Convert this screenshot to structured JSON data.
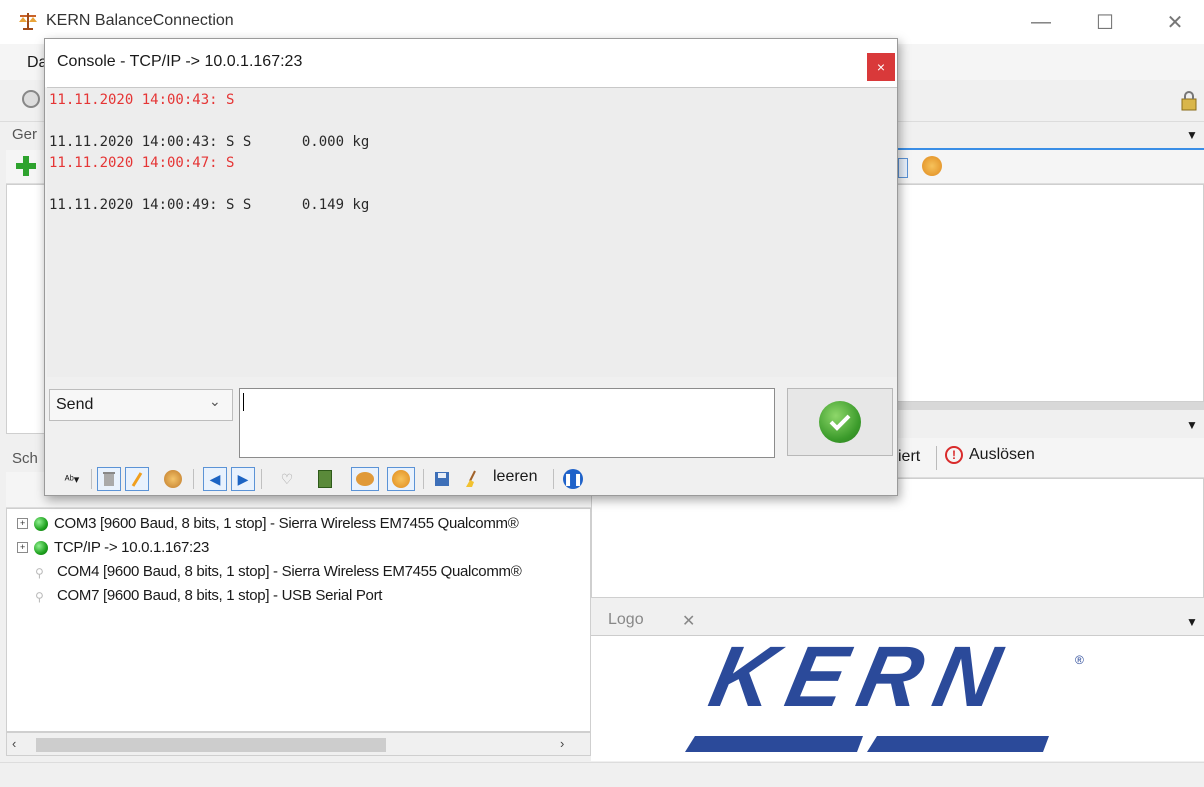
{
  "app": {
    "title": "KERN BalanceConnection",
    "menu_first": "Da",
    "minimize": "—",
    "maximize": "☐",
    "close": "✕"
  },
  "panels": {
    "left_top_label": "Ger",
    "left_bottom_label": "Sch",
    "right_toolbar_partial_label": "iert",
    "ausloesen_label": "Auslösen",
    "logo_tab": "Logo",
    "logo_tab_close": "✕"
  },
  "console": {
    "title": "Console - TCP/IP -> 10.0.1.167:23",
    "close": "×",
    "log": [
      {
        "text": "11.11.2020 14:00:43: S",
        "color": "red"
      },
      {
        "text": "",
        "color": "black"
      },
      {
        "text": "11.11.2020 14:00:43: S S      0.000 kg",
        "color": "black"
      },
      {
        "text": "11.11.2020 14:00:47: S",
        "color": "red"
      },
      {
        "text": "",
        "color": "black"
      },
      {
        "text": "11.11.2020 14:00:49: S S      0.149 kg",
        "color": "black"
      }
    ],
    "send_mode": "Send",
    "input_value": "",
    "toolbar_clear_label": "leeren"
  },
  "connections": [
    {
      "label": "COM3 [9600 Baud, 8 bits, 1 stop] - Sierra Wireless EM7455 Qualcomm®",
      "status": "connected",
      "expandable": true
    },
    {
      "label": "TCP/IP -> 10.0.1.167:23",
      "status": "connected",
      "expandable": true
    },
    {
      "label": "COM4 [9600 Baud, 8 bits, 1 stop] - Sierra Wireless EM7455 Qualcomm®",
      "status": "disconnected",
      "expandable": false
    },
    {
      "label": "COM7 [9600 Baud, 8 bits, 1 stop] - USB Serial Port",
      "status": "disconnected",
      "expandable": false
    }
  ],
  "logo": {
    "text": "KERN",
    "registered": "®"
  },
  "colors": {
    "log_red": "#e53535",
    "accent_blue": "#3a8ee6",
    "kern_blue": "#2b4a9a",
    "close_red": "#d9393a"
  }
}
